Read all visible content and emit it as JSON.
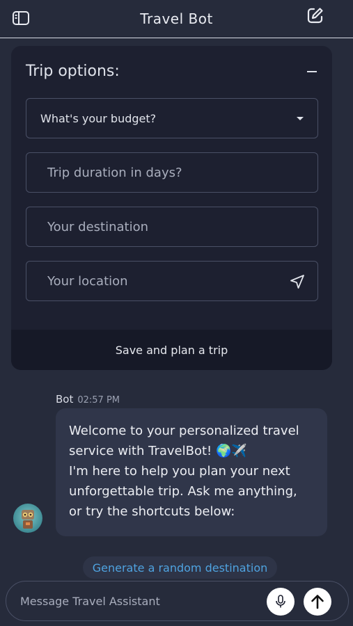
{
  "header": {
    "title": "Travel Bot",
    "left_icon": "sidebar-icon",
    "right_icon": "edit-icon"
  },
  "trip_options": {
    "title": "Trip options:",
    "budget_select": {
      "selected": "What's your budget?"
    },
    "duration_field": {
      "placeholder": "Trip duration in days?"
    },
    "destination_field": {
      "placeholder": "Your destination"
    },
    "location_field": {
      "placeholder": "Your location"
    },
    "save_label": "Save and plan a trip"
  },
  "chat": {
    "sender": "Bot",
    "time": "02:57 PM",
    "message": "Welcome to your personalized travel\nservice with TravelBot! 🌍✈️\nI'm here to help you plan your next\nunforgettable trip. Ask me anything,\nor try the shortcuts below:",
    "shortcut": "Generate a random destination"
  },
  "composer": {
    "placeholder": "Message Travel Assistant"
  },
  "colors": {
    "background": "#262b3b",
    "card": "#1d2030",
    "bubble": "#30364a",
    "link": "#4fa3e0"
  }
}
